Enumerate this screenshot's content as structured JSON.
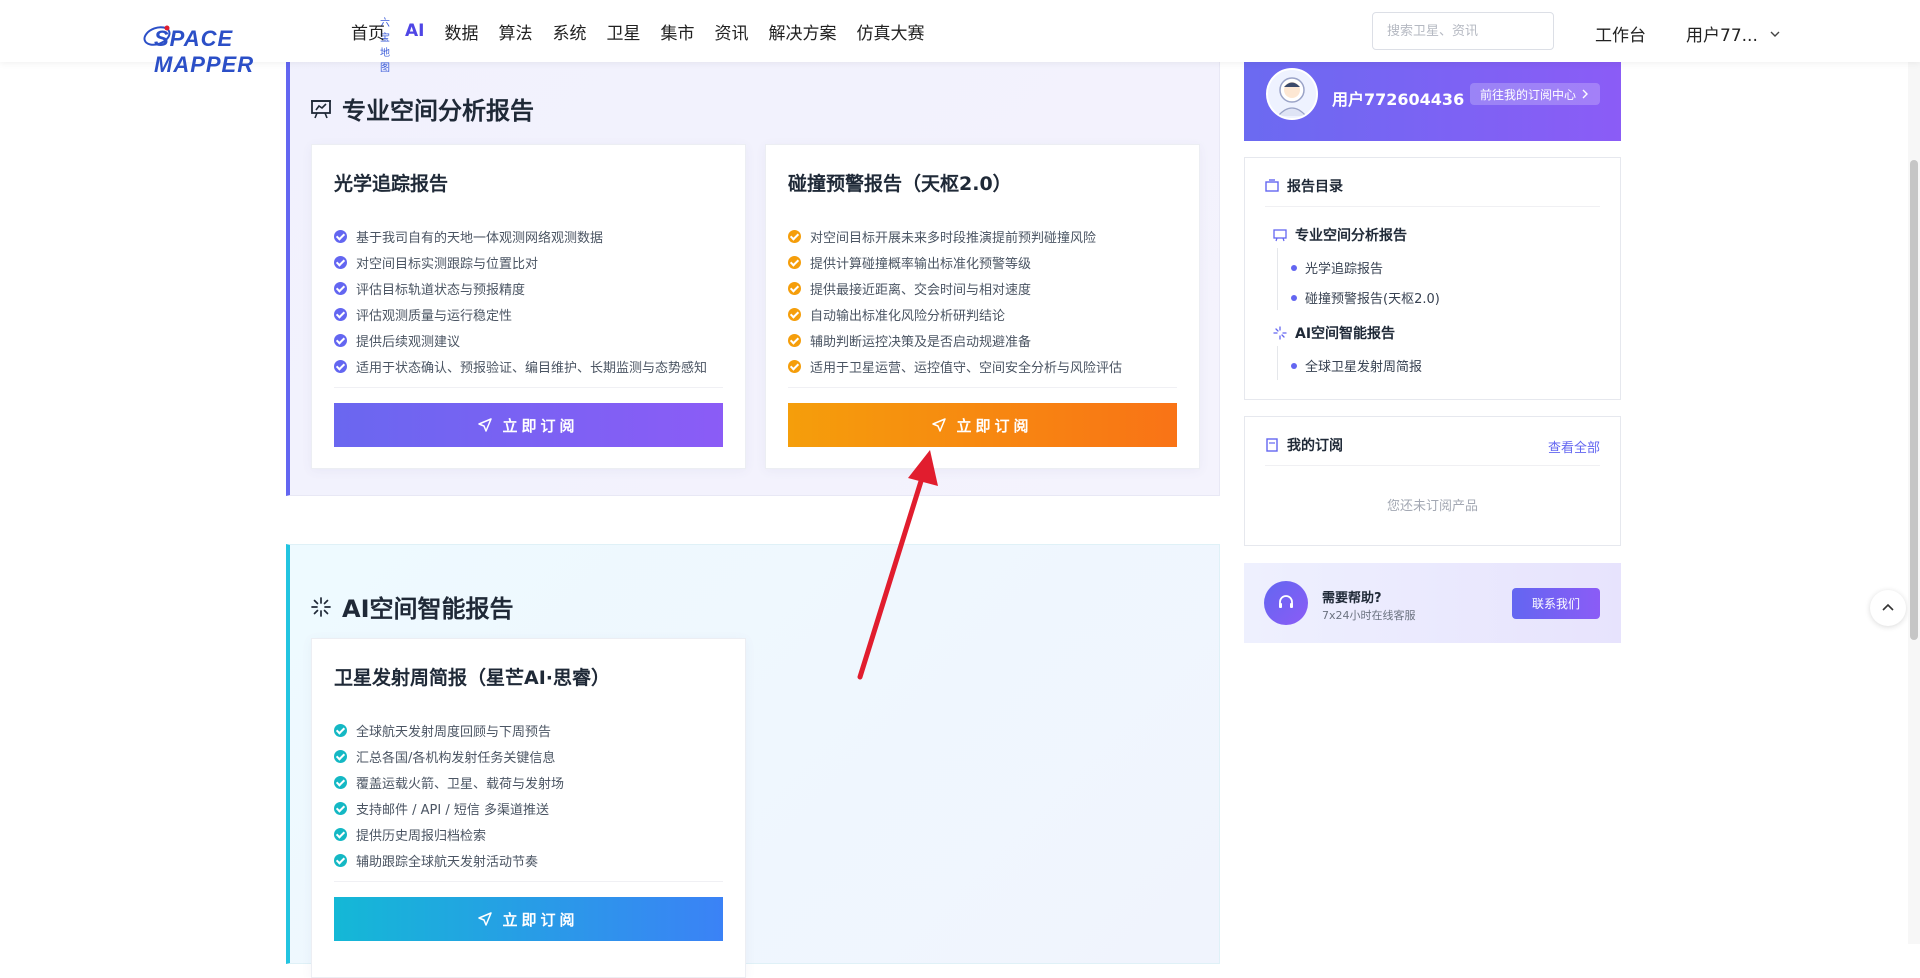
{
  "header": {
    "logo_main": "SPACE MAPPER",
    "logo_sub": "六宝地图",
    "nav": [
      "首页",
      "AI",
      "数据",
      "算法",
      "系统",
      "卫星",
      "集市",
      "资讯",
      "解决方案",
      "仿真大赛"
    ],
    "active_nav": "AI",
    "search_placeholder": "搜索卫星、资讯",
    "workbench": "工作台",
    "user_short": "用户77..."
  },
  "pro_section": {
    "title": "专业空间分析报告",
    "cards": [
      {
        "title": "光学追踪报告",
        "features": [
          "基于我司自有的天地一体观测网络观测数据",
          "对空间目标实测跟踪与位置比对",
          "评估目标轨道状态与预报精度",
          "评估观测质量与运行稳定性",
          "提供后续观测建议",
          "适用于状态确认、预报验证、编目维护、长期监测与态势感知"
        ],
        "button": "立即订阅",
        "accent": "#6366f1"
      },
      {
        "title": "碰撞预警报告（天枢2.0）",
        "features": [
          "对空间目标开展未来多时段推演提前预判碰撞风险",
          "提供计算碰撞概率输出标准化预警等级",
          "提供最接近距离、交会时间与相对速度",
          "自动输出标准化风险分析研判结论",
          "辅助判断运控决策及是否启动规避准备",
          "适用于卫星运营、运控值守、空间安全分析与风险评估"
        ],
        "button": "立即订阅",
        "accent": "#f59e0b"
      }
    ]
  },
  "ai_section": {
    "title": "AI空间智能报告",
    "cards": [
      {
        "title": "卫星发射周简报（星芒AI·思睿）",
        "features": [
          "全球航天发射周度回顾与下周预告",
          "汇总各国/各机构发射任务关键信息",
          "覆盖运载火箭、卫星、载荷与发射场",
          "支持邮件 / API / 短信 多渠道推送",
          "提供历史周报归档检索",
          "辅助跟踪全球航天发射活动节奏"
        ],
        "button": "立即订阅",
        "accent": "#14b8c4"
      }
    ]
  },
  "sidebar": {
    "user_name": "用户772604436",
    "orders_link": "前往我的订阅中心",
    "toc_title": "报告目录",
    "toc": [
      {
        "group": "专业空间分析报告",
        "items": [
          "光学追踪报告",
          "碰撞预警报告(天枢2.0)"
        ]
      },
      {
        "group": "AI空间智能报告",
        "items": [
          "全球卫星发射周简报"
        ]
      }
    ],
    "subs_title": "我的订阅",
    "view_all": "查看全部",
    "empty": "您还未订阅产品",
    "help_title": "需要帮助?",
    "help_sub": "7x24小时在线客服",
    "contact": "联系我们"
  },
  "colors": {
    "primary": "#6366f1",
    "orange": "#f59e0b",
    "cyan": "#14b8c4",
    "annotation_arrow": "#e11d2e"
  }
}
